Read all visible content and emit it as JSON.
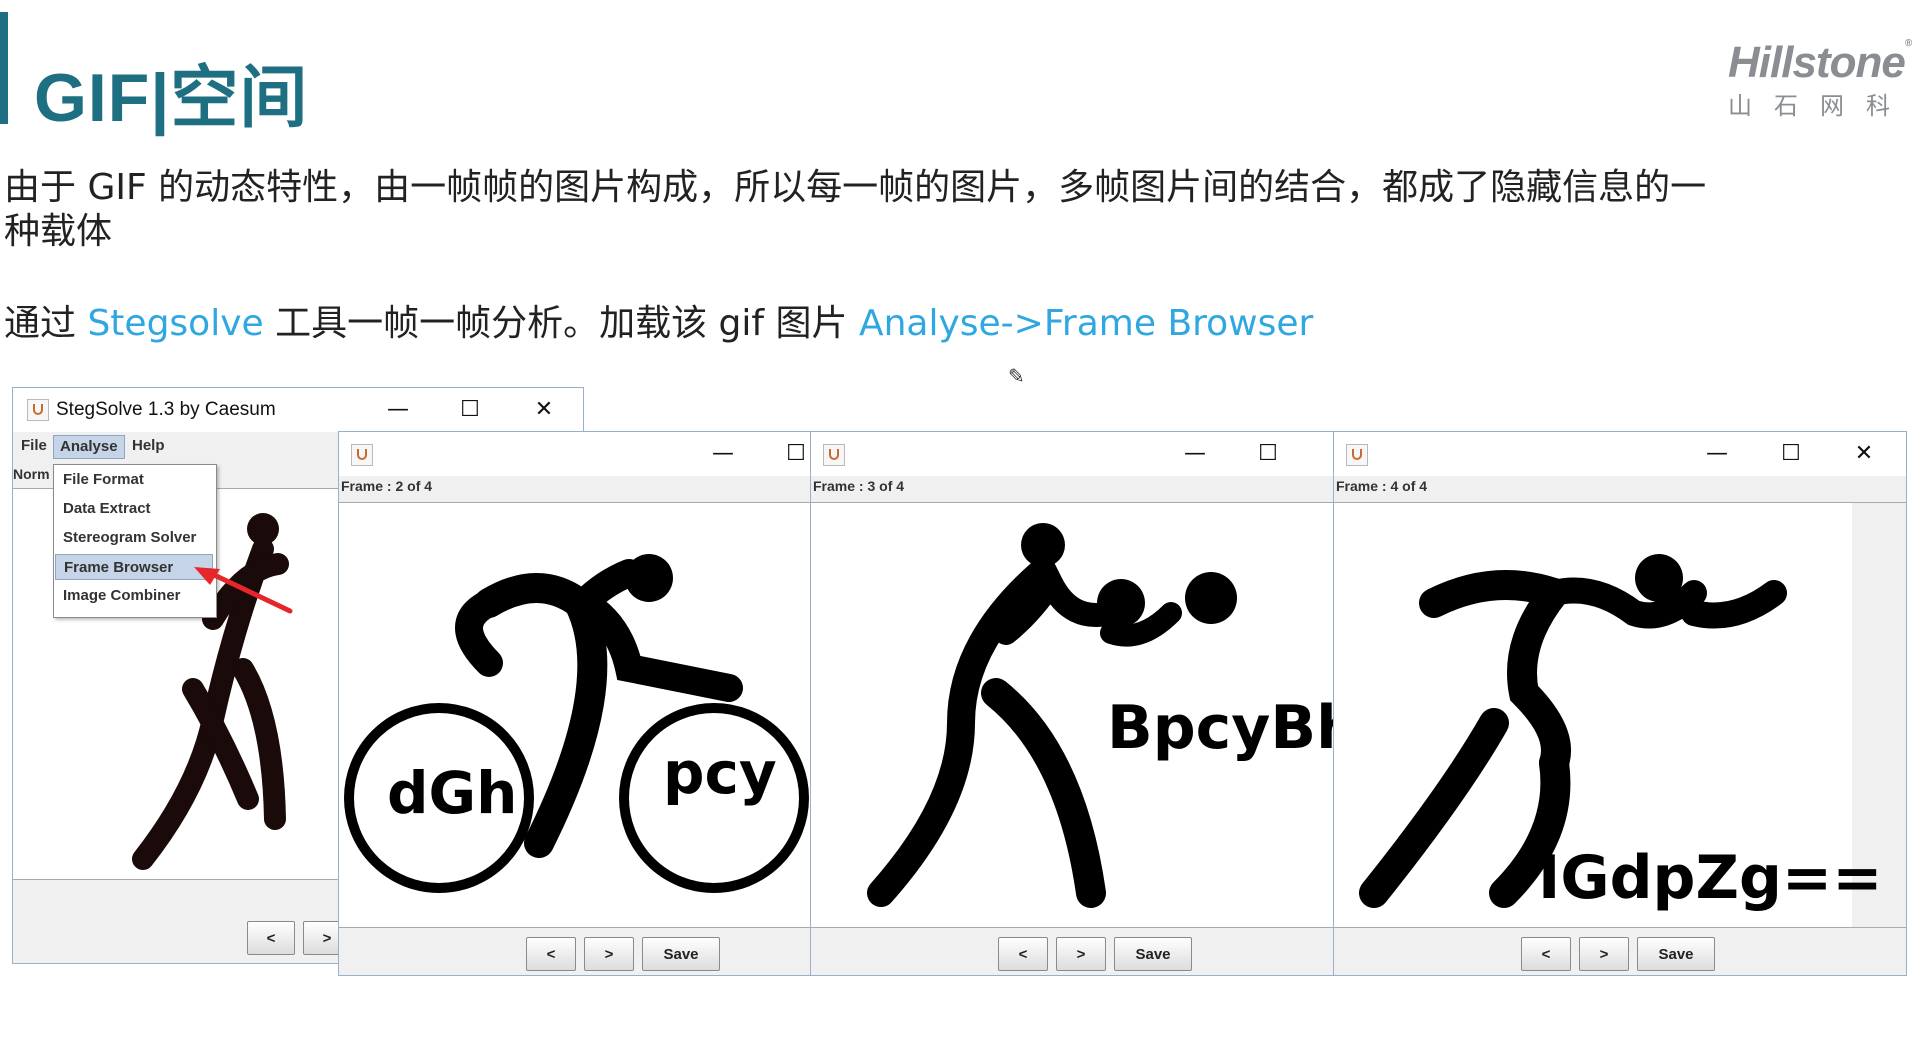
{
  "slide": {
    "title": "GIF|空间",
    "logo_en": "Hillstone",
    "logo_reg": "®",
    "logo_cn": "山石网科",
    "para1": "由于 GIF 的动态特性，由一帧帧的图片构成，所以每一帧的图片，多帧图片间的结合，都成了隐藏信息的一种载体",
    "para2_a": "通过 ",
    "para2_link1": "Stegsolve",
    "para2_b": " 工具一帧一帧分析。加载该 gif 图片 ",
    "para2_link2": "Analyse->Frame Browser"
  },
  "colors": {
    "accent": "#1f6f82",
    "link": "#2fa7e0",
    "arrow": "#e5262b"
  },
  "main_window": {
    "title": "StegSolve 1.3 by Caesum",
    "minimize": "—",
    "maximize": "☐",
    "close": "✕",
    "menu": {
      "file": "File",
      "analyse": "Analyse",
      "help": "Help"
    },
    "status_text": "Norm",
    "dropdown": [
      "File Format",
      "Data Extract",
      "Stereogram Solver",
      "Frame Browser",
      "Image Combiner"
    ],
    "selected_item": "Frame Browser",
    "prev": "<",
    "next": ">"
  },
  "frames": [
    {
      "label": "Frame : 2 of 4",
      "texts": [
        "dGh",
        "pcy"
      ],
      "prev": "<",
      "next": ">",
      "save": "Save",
      "minimize": "—",
      "maximize": "☐"
    },
    {
      "label": "Frame : 3 of 4",
      "texts": [
        "BpcyBh"
      ],
      "prev": "<",
      "next": ">",
      "save": "Save",
      "minimize": "—",
      "maximize": "☐"
    },
    {
      "label": "Frame : 4 of 4",
      "texts": [
        "IGdpZg=="
      ],
      "prev": "<",
      "next": ">",
      "save": "Save",
      "minimize": "—",
      "maximize": "☐",
      "close": "✕"
    }
  ]
}
